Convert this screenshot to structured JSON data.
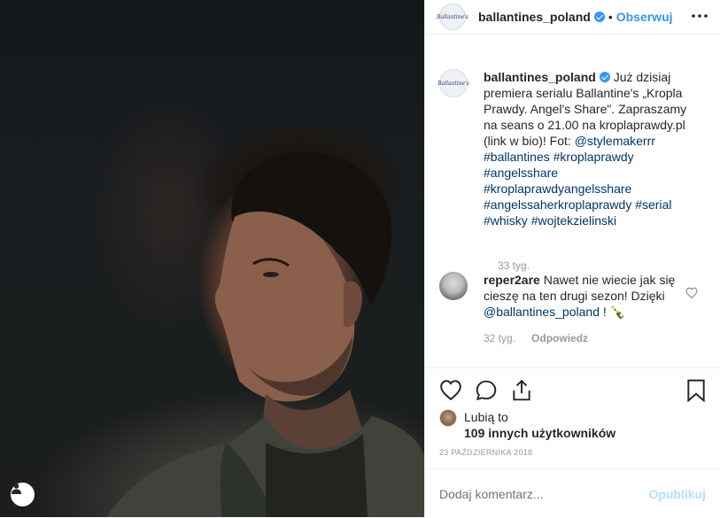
{
  "post": {
    "username": "ballantines_poland",
    "dot": "•",
    "follow_label": "Obserwuj",
    "more_icon": "more-horizontal-icon",
    "logo_text": "Ballantine's"
  },
  "caption": {
    "username": "ballantines_poland",
    "text": "Już dzisiaj premiera serialu Ballantine's „Kropla Prawdy. Angel's Share\". Zapraszamy na seans o 21.00 na kroplaprawdy.pl (link w bio)! Fot: ",
    "mention": "@stylemakerrr",
    "hashtags": [
      "#ballantines",
      "#kroplaprawdy",
      "#angelsshare",
      "#kroplaprawdyangelsshare",
      "#angelssaherkroplaprawdy",
      "#serial",
      "#whisky",
      "#wojtekzielinski"
    ],
    "time": "33 tyg."
  },
  "comment": {
    "username": "reper2are",
    "text": "Nawet nie wiecie jak się cieszę na ten drugi sezon! Dzięki ",
    "mention": "@ballantines_poland",
    "suffix": " ! 🍾",
    "time": "32 tyg.",
    "reply_label": "Odpowiedz"
  },
  "likes": {
    "line1": "Lubią to",
    "line2": "109 innych użytkowników"
  },
  "date": "23 PAŹDZIERNIKA 2018",
  "add_comment": {
    "placeholder": "Dodaj komentarz...",
    "publish_label": "Opublikuj"
  },
  "colors": {
    "link": "#3897f0",
    "hashtag": "#003569",
    "muted": "#999999",
    "publish_disabled": "#b2dffc"
  }
}
